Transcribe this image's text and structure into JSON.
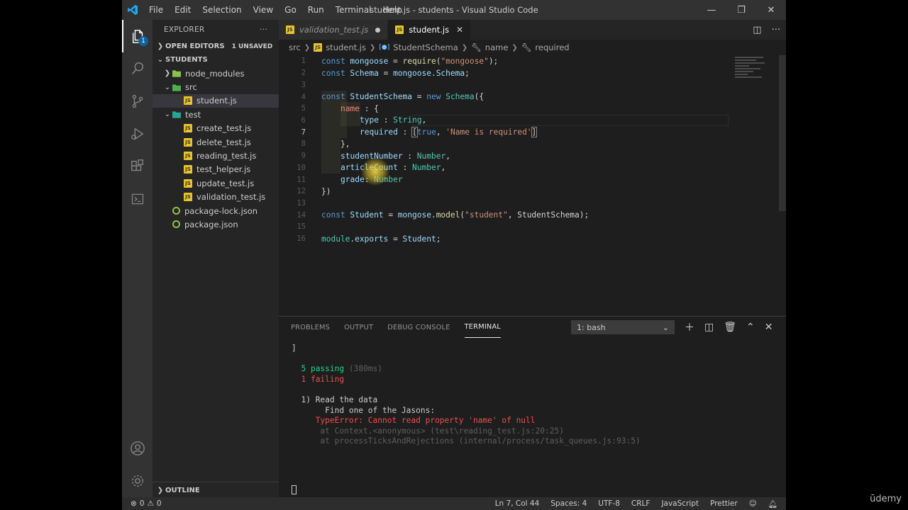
{
  "titlebar": {
    "title": "student.js - students - Visual Studio Code",
    "menu": [
      "File",
      "Edit",
      "Selection",
      "View",
      "Go",
      "Run",
      "Terminal",
      "Help"
    ]
  },
  "activitybar": {
    "explorer_badge": "1"
  },
  "sidebar": {
    "header": "EXPLORER",
    "open_editors": "OPEN EDITORS",
    "unsaved": "1 UNSAVED",
    "root": "STUDENTS",
    "outline": "OUTLINE",
    "tree": [
      {
        "label": "node_modules",
        "kind": "folder-closed",
        "depth": 1
      },
      {
        "label": "src",
        "kind": "folder-open",
        "depth": 1
      },
      {
        "label": "student.js",
        "kind": "js",
        "depth": 2,
        "selected": true
      },
      {
        "label": "test",
        "kind": "folder-open",
        "depth": 1
      },
      {
        "label": "create_test.js",
        "kind": "js",
        "depth": 2
      },
      {
        "label": "delete_test.js",
        "kind": "js",
        "depth": 2
      },
      {
        "label": "reading_test.js",
        "kind": "js",
        "depth": 2
      },
      {
        "label": "test_helper.js",
        "kind": "js",
        "depth": 2
      },
      {
        "label": "update_test.js",
        "kind": "js",
        "depth": 2
      },
      {
        "label": "validation_test.js",
        "kind": "js",
        "depth": 2
      },
      {
        "label": "package-lock.json",
        "kind": "json",
        "depth": 1
      },
      {
        "label": "package.json",
        "kind": "json",
        "depth": 1
      }
    ]
  },
  "tabs": [
    {
      "label": "validation_test.js",
      "unsaved": true,
      "active": false
    },
    {
      "label": "student.js",
      "unsaved": false,
      "active": true
    }
  ],
  "breadcrumb": [
    "src",
    "student.js",
    "StudentSchema",
    "name",
    "required"
  ],
  "code": [
    {
      "n": "1"
    },
    {
      "n": "2"
    },
    {
      "n": "3"
    },
    {
      "n": "4"
    },
    {
      "n": "5"
    },
    {
      "n": "6"
    },
    {
      "n": "7"
    },
    {
      "n": "8"
    },
    {
      "n": "9"
    },
    {
      "n": "10"
    },
    {
      "n": "11"
    },
    {
      "n": "12"
    },
    {
      "n": "13"
    },
    {
      "n": "14"
    },
    {
      "n": "15"
    },
    {
      "n": "16"
    }
  ],
  "code_tokens": {
    "l1": [
      "const",
      " mongoose ",
      "=",
      " ",
      "require",
      "(",
      "\"mongoose\"",
      ");"
    ],
    "l2": [
      "const",
      " Schema ",
      "=",
      " mongoose.",
      "Schema",
      ";"
    ],
    "l4": [
      "const",
      " StudentSchema ",
      "=",
      " ",
      "new",
      " ",
      "Schema",
      "({"
    ],
    "l5": [
      "name",
      " : {"
    ],
    "l6": [
      "type",
      " : ",
      "String",
      ","
    ],
    "l7": [
      "required",
      " : ",
      "[",
      "true",
      ", ",
      "'Name is required'",
      "]"
    ],
    "l8": [
      "},"
    ],
    "l9": [
      "studentNumber",
      " : ",
      "Number",
      ","
    ],
    "l10": [
      "articleCount",
      " : ",
      "Number",
      ","
    ],
    "l11": [
      "grade",
      ": ",
      "Number"
    ],
    "l12": [
      "})"
    ],
    "l14": [
      "const",
      " Student ",
      "=",
      " mongose.",
      "model",
      "(",
      "\"student\"",
      ", StudentSchema);"
    ],
    "l16": [
      "module",
      ".",
      "exports",
      " = ",
      "Student",
      ";"
    ]
  },
  "panel": {
    "tabs": [
      "PROBLEMS",
      "OUTPUT",
      "DEBUG CONSOLE",
      "TERMINAL"
    ],
    "terminal_select": "1: bash",
    "lines": {
      "bracket": "]",
      "passing": "5 passing",
      "passing_time": "(380ms)",
      "failing": "1 failing",
      "err_title": "1) Read the data",
      "err_sub": "Find one of the Jasons:",
      "err_msg": "TypeError: Cannot read property 'name' of null",
      "stack1": "at Context.<anonymous> (test\\reading_test.js:20:25)",
      "stack2": "at processTicksAndRejections (internal/process/task_queues.js:93:5)"
    }
  },
  "statusbar": {
    "errors": "0",
    "warnings": "0",
    "position": "Ln 7, Col 44",
    "spaces": "Spaces: 4",
    "encoding": "UTF-8",
    "eol": "CRLF",
    "language": "JavaScript",
    "formatter": "Prettier"
  },
  "watermark": "ūdemy"
}
